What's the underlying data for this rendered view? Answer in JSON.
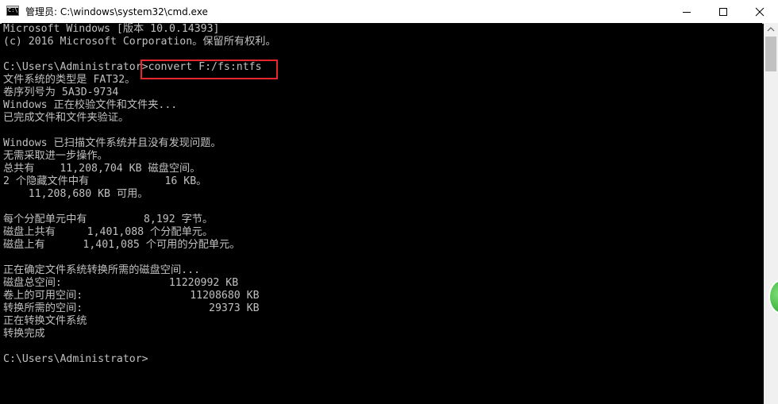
{
  "window": {
    "title": "管理员: C:\\windows\\system32\\cmd.exe",
    "icon_label": "C:\\"
  },
  "console": {
    "lines": [
      "Microsoft Windows [版本 10.0.14393]",
      "(c) 2016 Microsoft Corporation。保留所有权利。",
      "",
      "C:\\Users\\Administrator>convert F:/fs:ntfs",
      "文件系统的类型是 FAT32。",
      "卷序列号为 5A3D-9734",
      "Windows 正在校验文件和文件夹...",
      "已完成文件和文件夹验证。",
      "",
      "Windows 已扫描文件系统并且没有发现问题。",
      "无需采取进一步操作。",
      "总共有    11,208,704 KB 磁盘空间。",
      "2 个隐藏文件中有            16 KB。",
      "    11,208,680 KB 可用。",
      "",
      "每个分配单元中有         8,192 字节。",
      "磁盘上共有     1,401,088 个分配单元。",
      "磁盘上有      1,401,085 个可用的分配单元。",
      "",
      "正在确定文件系统转换所需的磁盘空间...",
      "磁盘总空间:                 11220992 KB",
      "卷上的可用空间:                 11208680 KB",
      "转换所需的空间:                    29373 KB",
      "正在转换文件系统",
      "转换完成",
      "",
      "C:\\Users\\Administrator>"
    ]
  },
  "icons": {
    "minimize": "minimize-icon",
    "maximize": "maximize-icon",
    "close": "close-icon",
    "scroll_up": "chevron-up-icon"
  },
  "colors": {
    "console_bg": "#000000",
    "console_text": "#c0c0c0",
    "highlight_border": "#e8262d"
  }
}
